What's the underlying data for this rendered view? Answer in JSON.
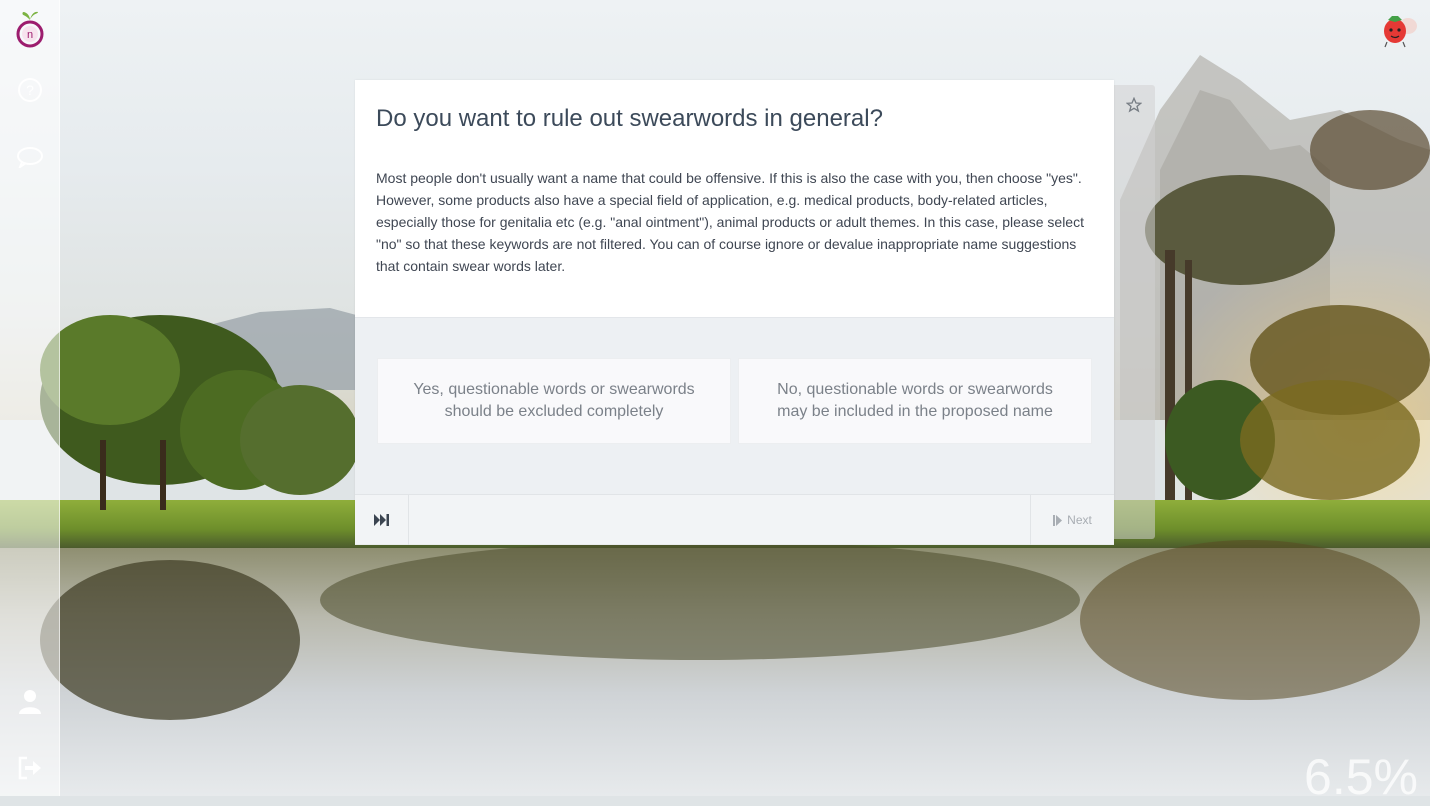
{
  "question": {
    "title": "Do you want to rule out swearwords in general?",
    "description": "Most people don't usually want a name that could be offensive. If this is also the case with you, then choose \"yes\". However, some products also have a special field of application, e.g. medical products, body-related articles, especially those for genitalia etc (e.g. \"anal ointment\"), animal products or adult themes. In this case, please select \"no\" so that these keywords are not filtered. You can of course ignore or devalue inappropriate name suggestions that contain swear words later."
  },
  "answers": [
    {
      "label": "Yes, questionable words or swearwords should be excluded completely"
    },
    {
      "label": "No, questionable words or swearwords may be included in the proposed name"
    }
  ],
  "footer": {
    "next_label": "Next",
    "skip_icon": "skip-forward-icon",
    "next_icon": "step-forward-icon"
  },
  "progress": {
    "label": "6.5%",
    "value": 6.5
  },
  "sidebar": {
    "icons": [
      "logo-icon",
      "help-icon",
      "chat-icon",
      "user-icon",
      "logout-icon"
    ]
  },
  "colors": {
    "logo_ring": "#9c1d6e",
    "logo_leaf": "#7cb342",
    "title_text": "#3c4a5a",
    "answer_text": "#7b8189"
  }
}
